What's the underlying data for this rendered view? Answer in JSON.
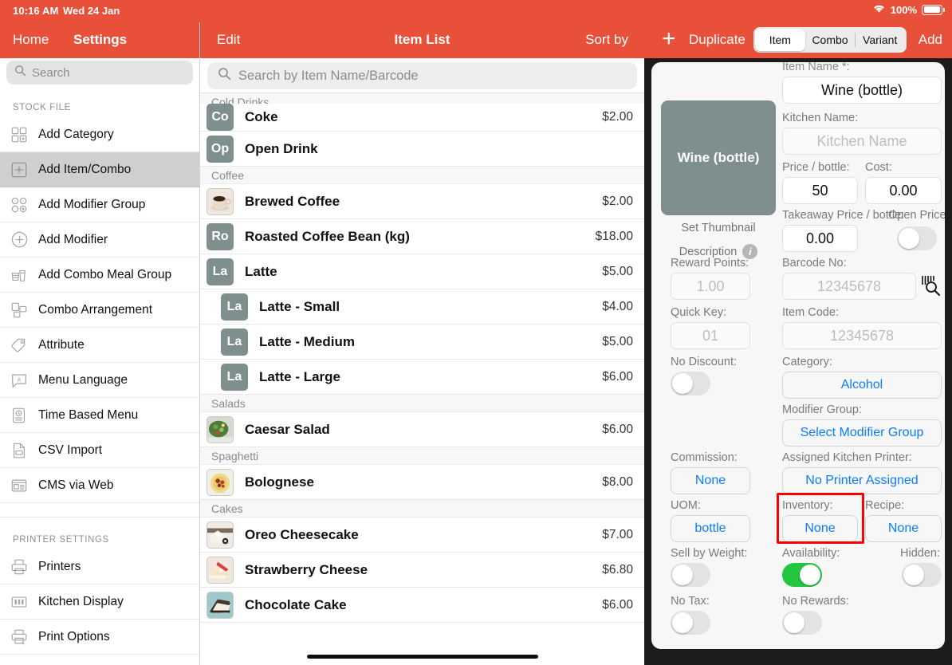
{
  "statusbar": {
    "time": "10:16 AM",
    "date": "Wed 24 Jan",
    "battery_pct": "100%",
    "wifi_icon": "wifi-icon",
    "battery_icon": "battery-icon"
  },
  "left_panel": {
    "nav": {
      "home": "Home",
      "settings": "Settings"
    },
    "search": {
      "placeholder": "Search",
      "icon": "search-icon"
    },
    "sections": [
      {
        "header": "STOCK FILE",
        "items": [
          {
            "label": "Add Category",
            "icon": "add-category-icon",
            "selected": false
          },
          {
            "label": "Add Item/Combo",
            "icon": "add-item-combo-icon",
            "selected": true
          },
          {
            "label": "Add Modifier Group",
            "icon": "add-modifier-group-icon",
            "selected": false
          },
          {
            "label": "Add Modifier",
            "icon": "add-modifier-icon",
            "selected": false
          },
          {
            "label": "Add Combo Meal Group",
            "icon": "combo-meal-group-icon",
            "selected": false
          },
          {
            "label": "Combo Arrangement",
            "icon": "combo-arrangement-icon",
            "selected": false
          },
          {
            "label": "Attribute",
            "icon": "tag-icon",
            "selected": false
          },
          {
            "label": "Menu Language",
            "icon": "menu-language-icon",
            "selected": false
          },
          {
            "label": "Time Based Menu",
            "icon": "time-based-menu-icon",
            "selected": false
          },
          {
            "label": "CSV Import",
            "icon": "csv-import-icon",
            "selected": false
          },
          {
            "label": "CMS via Web",
            "icon": "cms-web-icon",
            "selected": false
          }
        ]
      },
      {
        "header": "PRINTER SETTINGS",
        "items": [
          {
            "label": "Printers",
            "icon": "printer-icon",
            "selected": false
          },
          {
            "label": "Kitchen Display",
            "icon": "kitchen-display-icon",
            "selected": false
          },
          {
            "label": "Print Options",
            "icon": "print-options-icon",
            "selected": false
          }
        ]
      }
    ]
  },
  "mid_panel": {
    "nav": {
      "edit": "Edit",
      "title": "Item List",
      "sort_by": "Sort by"
    },
    "search": {
      "placeholder": "Search by Item Name/Barcode",
      "icon": "search-icon"
    },
    "groups": [
      {
        "name": "Cold Drinks",
        "items": [
          {
            "name": "Coke",
            "price": "$2.00",
            "badge": "Co",
            "thumb_type": "initials",
            "clipped": true,
            "variant": false
          },
          {
            "name": "Open Drink",
            "price": "",
            "badge": "Op",
            "thumb_type": "initials",
            "clipped": false,
            "variant": false
          }
        ]
      },
      {
        "name": "Coffee",
        "items": [
          {
            "name": "Brewed Coffee",
            "price": "$2.00",
            "badge": "",
            "thumb_type": "photo-coffee",
            "clipped": false,
            "variant": false
          },
          {
            "name": "Roasted Coffee Bean (kg)",
            "price": "$18.00",
            "badge": "Ro",
            "thumb_type": "initials",
            "clipped": false,
            "variant": false
          },
          {
            "name": "Latte",
            "price": "$5.00",
            "badge": "La",
            "thumb_type": "initials",
            "clipped": false,
            "variant": false
          },
          {
            "name": "Latte - Small",
            "price": "$4.00",
            "badge": "La",
            "thumb_type": "initials",
            "clipped": false,
            "variant": true
          },
          {
            "name": "Latte - Medium",
            "price": "$5.00",
            "badge": "La",
            "thumb_type": "initials",
            "clipped": false,
            "variant": true
          },
          {
            "name": "Latte - Large",
            "price": "$6.00",
            "badge": "La",
            "thumb_type": "initials",
            "clipped": false,
            "variant": true
          }
        ]
      },
      {
        "name": "Salads",
        "items": [
          {
            "name": "Caesar Salad",
            "price": "$6.00",
            "badge": "",
            "thumb_type": "photo-salad",
            "clipped": false,
            "variant": false
          }
        ]
      },
      {
        "name": "Spaghetti",
        "items": [
          {
            "name": "Bolognese",
            "price": "$8.00",
            "badge": "",
            "thumb_type": "photo-pasta",
            "clipped": false,
            "variant": false
          }
        ]
      },
      {
        "name": "Cakes",
        "items": [
          {
            "name": "Oreo Cheesecake",
            "price": "$7.00",
            "badge": "",
            "thumb_type": "photo-oreo",
            "clipped": false,
            "variant": false
          },
          {
            "name": "Strawberry Cheese",
            "price": "$6.80",
            "badge": "",
            "thumb_type": "photo-strawberry",
            "clipped": false,
            "variant": false
          },
          {
            "name": "Chocolate Cake",
            "price": "$6.00",
            "badge": "",
            "thumb_type": "photo-choc",
            "clipped": false,
            "variant": false
          }
        ]
      }
    ]
  },
  "right_panel": {
    "nav": {
      "plus_icon": "plus-icon",
      "duplicate": "Duplicate",
      "add": "Add",
      "segments": [
        {
          "label": "Item",
          "active": true
        },
        {
          "label": "Combo",
          "active": false
        },
        {
          "label": "Variant",
          "active": false
        }
      ]
    },
    "thumbnail": {
      "text": "Wine (bottle)",
      "caption": "Set Thumbnail",
      "description_label": "Description",
      "info_icon": "info-icon"
    },
    "fields": {
      "item_name_label": "Item Name *:",
      "item_name_value": "Wine (bottle)",
      "kitchen_name_label": "Kitchen Name:",
      "kitchen_name_placeholder": "Kitchen Name",
      "price_label": "Price / bottle:",
      "price_value": "50",
      "cost_label": "Cost:",
      "cost_value": "0.00",
      "takeaway_label": "Takeaway Price / bottle:",
      "takeaway_value": "0.00",
      "open_price_label": "Open Price:",
      "open_price_on": false,
      "reward_points_label": "Reward Points:",
      "reward_points_placeholder": "1.00",
      "barcode_label": "Barcode No:",
      "barcode_placeholder": "12345678",
      "barcode_scan_icon": "barcode-scan-icon",
      "quick_key_label": "Quick Key:",
      "quick_key_placeholder": "01",
      "item_code_label": "Item Code:",
      "item_code_placeholder": "12345678",
      "no_discount_label": "No Discount:",
      "no_discount_on": false,
      "category_label": "Category:",
      "category_value": "Alcohol",
      "modifier_group_label": "Modifier Group:",
      "modifier_group_value": "Select Modifier Group",
      "commission_label": "Commission:",
      "commission_value": "None",
      "kitchen_printer_label": "Assigned Kitchen Printer:",
      "kitchen_printer_value": "No Printer Assigned",
      "uom_label": "UOM:",
      "uom_value": "bottle",
      "inventory_label": "Inventory:",
      "inventory_value": "None",
      "recipe_label": "Recipe:",
      "recipe_value": "None",
      "sell_by_weight_label": "Sell by Weight:",
      "sell_by_weight_on": false,
      "availability_label": "Availability:",
      "availability_on": true,
      "hidden_label": "Hidden:",
      "hidden_on": false,
      "no_tax_label": "No Tax:",
      "no_tax_on": false,
      "no_rewards_label": "No Rewards:",
      "no_rewards_on": false
    },
    "highlight": {
      "target": "inventory-field",
      "color": "#FF0000"
    }
  },
  "colors": {
    "brand_red": "#E8503A",
    "link_blue": "#0a7cff",
    "toggle_green": "#22C63F",
    "thumb_grey": "#7E8F8D",
    "highlight_red": "#FF0000"
  }
}
